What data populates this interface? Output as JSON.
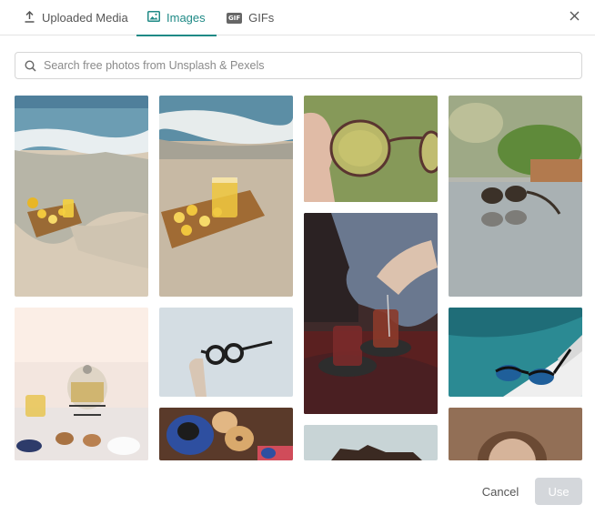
{
  "tabs": {
    "uploaded": {
      "label": "Uploaded Media",
      "icon": "upload-icon"
    },
    "images": {
      "label": "Images",
      "icon": "image-icon",
      "active": true
    },
    "gifs": {
      "label": "GIFs",
      "icon": "gif-icon",
      "badge": "GIF"
    }
  },
  "close": {
    "icon": "close-icon"
  },
  "search": {
    "placeholder": "Search free photos from Unsplash & Pexels",
    "value": "",
    "icon": "search-icon"
  },
  "gallery": {
    "images": [
      {
        "subject": "beach-lemonade-board"
      },
      {
        "subject": "beach-lemonade-glasses"
      },
      {
        "subject": "hand-holding-glasses"
      },
      {
        "subject": "sunglasses-reflection"
      },
      {
        "subject": "pouring-tea"
      },
      {
        "subject": "tea-set-cakes"
      },
      {
        "subject": "hand-holding-black-glasses"
      },
      {
        "subject": "sunglasses-pool"
      },
      {
        "subject": "coffee-bagels"
      },
      {
        "subject": "wallet-partial"
      },
      {
        "subject": "woman-portrait-partial"
      }
    ]
  },
  "footer": {
    "cancel_label": "Cancel",
    "use_label": "Use"
  },
  "colors": {
    "accent": "#1f8a86",
    "disabled_button": "#d4d7db"
  }
}
